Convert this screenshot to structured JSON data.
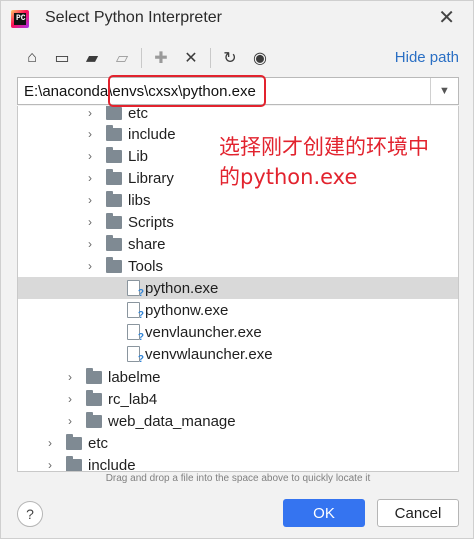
{
  "window": {
    "title": "Select Python Interpreter"
  },
  "toolbar": {
    "hide_path_label": "Hide path",
    "icons": [
      "home-icon",
      "desktop-icon",
      "project-folder-icon",
      "module-folder-icon",
      "new-folder-icon",
      "delete-icon",
      "refresh-icon",
      "show-hidden-icon"
    ]
  },
  "path": {
    "value": "E:\\anaconda\\envs\\cxsx\\python.exe"
  },
  "tree": {
    "rows": [
      {
        "label": "etc",
        "type": "folder",
        "expandable": true
      },
      {
        "label": "include",
        "type": "folder",
        "expandable": true
      },
      {
        "label": "Lib",
        "type": "folder",
        "expandable": true
      },
      {
        "label": "Library",
        "type": "folder",
        "expandable": true
      },
      {
        "label": "libs",
        "type": "folder",
        "expandable": true
      },
      {
        "label": "Scripts",
        "type": "folder",
        "expandable": true
      },
      {
        "label": "share",
        "type": "folder",
        "expandable": true
      },
      {
        "label": "Tools",
        "type": "folder",
        "expandable": true
      },
      {
        "label": "python.exe",
        "type": "file",
        "selected": true
      },
      {
        "label": "pythonw.exe",
        "type": "file"
      },
      {
        "label": "venvlauncher.exe",
        "type": "file"
      },
      {
        "label": "venvwlauncher.exe",
        "type": "file"
      },
      {
        "label": "labelme",
        "type": "folder",
        "expandable": true
      },
      {
        "label": "rc_lab4",
        "type": "folder",
        "expandable": true
      },
      {
        "label": "web_data_manage",
        "type": "folder",
        "expandable": true
      },
      {
        "label": "etc",
        "type": "folder",
        "expandable": true
      },
      {
        "label": "include",
        "type": "folder",
        "expandable": true
      }
    ]
  },
  "annotation": {
    "text_line1": "选择刚才创建的环境中",
    "text_line2": "的python.exe",
    "color": "#e2232e"
  },
  "hint": "Drag and drop a file into the space above to quickly locate it",
  "buttons": {
    "help": "?",
    "ok": "OK",
    "cancel": "Cancel"
  },
  "colors": {
    "accent": "#3574f0",
    "link": "#2a6fc4",
    "highlight": "#e2232e"
  }
}
